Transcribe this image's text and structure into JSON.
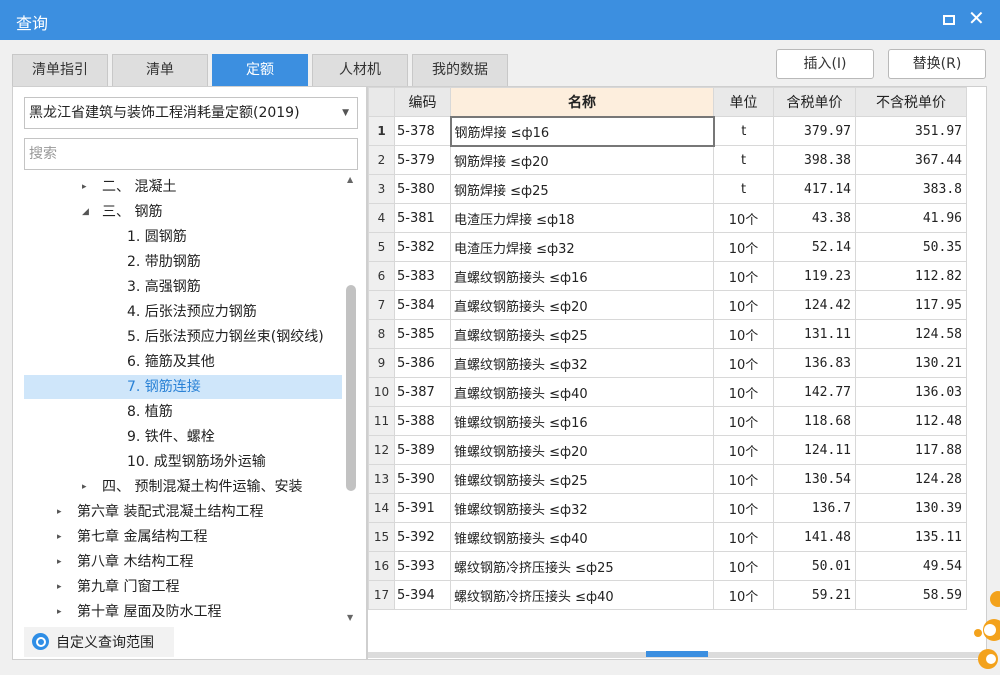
{
  "window": {
    "title": "查询"
  },
  "tabs": [
    "清单指引",
    "清单",
    "定额",
    "人材机",
    "我的数据"
  ],
  "active_tab": "定额",
  "buttons": {
    "insert": "插入(I)",
    "replace": "替换(R)"
  },
  "library": {
    "selected": "黑龙江省建筑与装饰工程消耗量定额(2019)"
  },
  "search": {
    "placeholder": "搜索"
  },
  "tree": [
    {
      "toggle": "▸",
      "label": "二、  混凝土"
    },
    {
      "toggle": "◢",
      "label": "三、  钢筋"
    },
    {
      "toggle": "",
      "label": "1. 圆钢筋"
    },
    {
      "toggle": "",
      "label": "2. 带肋钢筋"
    },
    {
      "toggle": "",
      "label": "3. 高强钢筋"
    },
    {
      "toggle": "",
      "label": "4. 后张法预应力钢筋"
    },
    {
      "toggle": "",
      "label": "5. 后张法预应力钢丝束(钢绞线)"
    },
    {
      "toggle": "",
      "label": "6. 箍筋及其他"
    },
    {
      "toggle": "",
      "label": "7. 钢筋连接"
    },
    {
      "toggle": "",
      "label": "8. 植筋"
    },
    {
      "toggle": "",
      "label": "9. 铁件、螺栓"
    },
    {
      "toggle": "",
      "label": "10. 成型钢筋场外运输"
    },
    {
      "toggle": "▸",
      "label": "四、  预制混凝土构件运输、安装"
    },
    {
      "toggle": "▸",
      "label": "第六章 装配式混凝土结构工程"
    },
    {
      "toggle": "▸",
      "label": "第七章 金属结构工程"
    },
    {
      "toggle": "▸",
      "label": "第八章 木结构工程"
    },
    {
      "toggle": "▸",
      "label": "第九章 门窗工程"
    },
    {
      "toggle": "▸",
      "label": "第十章 屋面及防水工程"
    }
  ],
  "tree_selected": "7. 钢筋连接",
  "custom_scope": "自定义查询范围",
  "table": {
    "headers": [
      "编码",
      "名称",
      "单位",
      "含税单价",
      "不含税单价"
    ],
    "rows": [
      {
        "no": "1",
        "code": "5-378",
        "name": "钢筋焊接  ≤ф16",
        "unit": "t",
        "tax": "379.97",
        "notax": "351.97"
      },
      {
        "no": "2",
        "code": "5-379",
        "name": "钢筋焊接  ≤ф20",
        "unit": "t",
        "tax": "398.38",
        "notax": "367.44"
      },
      {
        "no": "3",
        "code": "5-380",
        "name": "钢筋焊接  ≤ф25",
        "unit": "t",
        "tax": "417.14",
        "notax": "383.8"
      },
      {
        "no": "4",
        "code": "5-381",
        "name": "电渣压力焊接  ≤ф18",
        "unit": "10个",
        "tax": "43.38",
        "notax": "41.96"
      },
      {
        "no": "5",
        "code": "5-382",
        "name": "电渣压力焊接  ≤ф32",
        "unit": "10个",
        "tax": "52.14",
        "notax": "50.35"
      },
      {
        "no": "6",
        "code": "5-383",
        "name": "直螺纹钢筋接头  ≤ф16",
        "unit": "10个",
        "tax": "119.23",
        "notax": "112.82"
      },
      {
        "no": "7",
        "code": "5-384",
        "name": "直螺纹钢筋接头  ≤ф20",
        "unit": "10个",
        "tax": "124.42",
        "notax": "117.95"
      },
      {
        "no": "8",
        "code": "5-385",
        "name": "直螺纹钢筋接头  ≤ф25",
        "unit": "10个",
        "tax": "131.11",
        "notax": "124.58"
      },
      {
        "no": "9",
        "code": "5-386",
        "name": "直螺纹钢筋接头  ≤ф32",
        "unit": "10个",
        "tax": "136.83",
        "notax": "130.21"
      },
      {
        "no": "10",
        "code": "5-387",
        "name": "直螺纹钢筋接头  ≤ф40",
        "unit": "10个",
        "tax": "142.77",
        "notax": "136.03"
      },
      {
        "no": "11",
        "code": "5-388",
        "name": "锥螺纹钢筋接头  ≤ф16",
        "unit": "10个",
        "tax": "118.68",
        "notax": "112.48"
      },
      {
        "no": "12",
        "code": "5-389",
        "name": "锥螺纹钢筋接头  ≤ф20",
        "unit": "10个",
        "tax": "124.11",
        "notax": "117.88"
      },
      {
        "no": "13",
        "code": "5-390",
        "name": "锥螺纹钢筋接头  ≤ф25",
        "unit": "10个",
        "tax": "130.54",
        "notax": "124.28"
      },
      {
        "no": "14",
        "code": "5-391",
        "name": "锥螺纹钢筋接头  ≤ф32",
        "unit": "10个",
        "tax": "136.7",
        "notax": "130.39"
      },
      {
        "no": "15",
        "code": "5-392",
        "name": "锥螺纹钢筋接头  ≤ф40",
        "unit": "10个",
        "tax": "141.48",
        "notax": "135.11"
      },
      {
        "no": "16",
        "code": "5-393",
        "name": "螺纹钢筋冷挤压接头  ≤ф25",
        "unit": "10个",
        "tax": "50.01",
        "notax": "49.54"
      },
      {
        "no": "17",
        "code": "5-394",
        "name": "螺纹钢筋冷挤压接头  ≤ф40",
        "unit": "10个",
        "tax": "59.21",
        "notax": "58.59"
      }
    ],
    "current_row": "1"
  },
  "colors": {
    "accent": "#3c8fe0",
    "selected_bg": "#cfe6fa",
    "header_highlight": "#fdeedd"
  }
}
